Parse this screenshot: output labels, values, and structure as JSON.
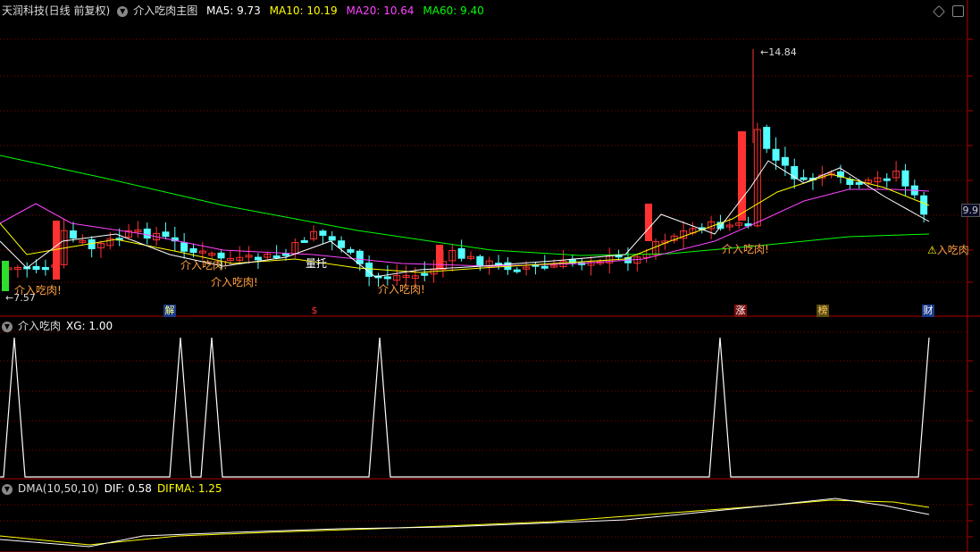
{
  "main_panel": {
    "stock_name": "天润科技(日线 前复权)",
    "indicator": "介入吃肉主图",
    "ma": [
      {
        "label": "MA5: 9.73",
        "color": "#ffffff"
      },
      {
        "label": "MA10: 10.19",
        "color": "#ffff00"
      },
      {
        "label": "MA20: 10.64",
        "color": "#ff44ff"
      },
      {
        "label": "MA60: 9.40",
        "color": "#00ff00"
      }
    ],
    "high_label": "14.84",
    "low_label": "7.57",
    "price_tag": "9.9",
    "signal_labels": [
      "介入吃肉!",
      "介入吃肉!",
      "介入吃肉!",
      "介入吃肉!",
      "介入吃肉!",
      "入吃肉"
    ],
    "annotation": "量托",
    "event_tags": [
      "解",
      "$",
      "涨",
      "榜",
      "财"
    ]
  },
  "xg_panel": {
    "title": "介入吃肉",
    "value": "XG: 1.00"
  },
  "dma_panel": {
    "title": "DMA(10,50,10)",
    "dif": "DIF: 0.58",
    "difma": "DIFMA: 1.25"
  },
  "colors": {
    "up": "#ff3232",
    "down": "#54ffff",
    "grid": "#8b0000",
    "ma5": "#ffffff",
    "ma10": "#ffff00",
    "ma20": "#ff44ff",
    "ma60": "#00ff00",
    "signal": "#ffa040"
  },
  "icons": [
    "expand-icon",
    "restore-icon",
    "indicator-menu-icon"
  ]
}
